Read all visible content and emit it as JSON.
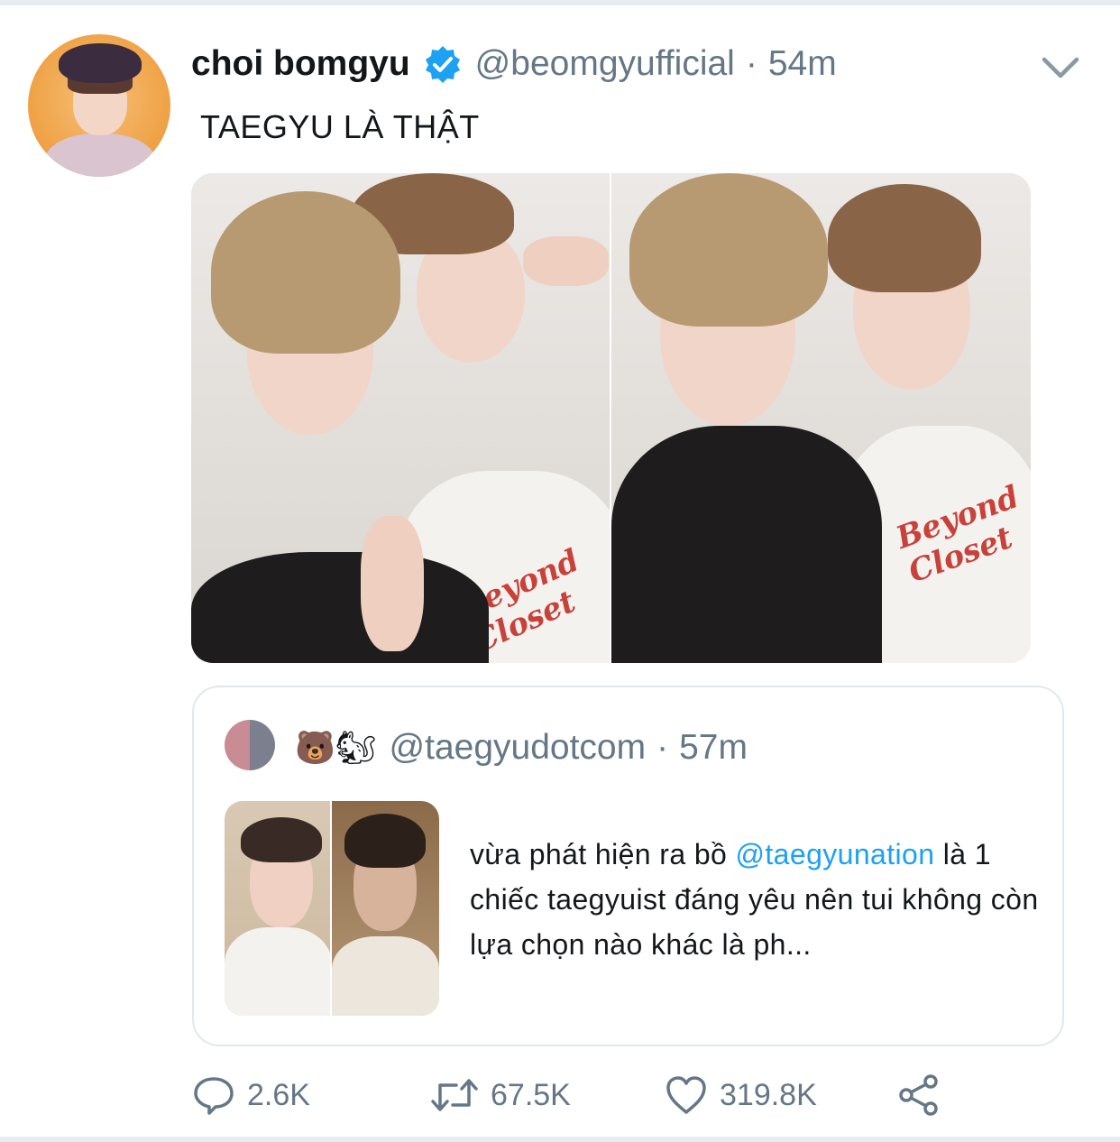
{
  "tweet": {
    "display_name": "choi bomgyu",
    "verified": true,
    "handle": "@beomgyufficial",
    "separator": "·",
    "time": "54m",
    "text": "TAEGYU LÀ THẬT",
    "media_count": 2
  },
  "quoted_tweet": {
    "emoji_name": "🐻🐿",
    "handle": "@taegyudotcom",
    "separator": "·",
    "time": "57m",
    "text_before": "vừa phát hiện ra bồ ",
    "mention": "@taegyunation",
    "text_after": " là 1 chiếc taegyuist đáng yêu nên tui không còn lựa chọn nào khác là ph..."
  },
  "actions": {
    "reply_count": "2.6K",
    "retweet_count": "67.5K",
    "like_count": "319.8K"
  },
  "colors": {
    "accent": "#1da1f2",
    "muted": "#657786",
    "text": "#14171a",
    "border": "#e1e8ed"
  },
  "icons": [
    "verified-badge-icon",
    "chevron-down-icon",
    "reply-icon",
    "retweet-icon",
    "like-icon",
    "share-icon"
  ]
}
